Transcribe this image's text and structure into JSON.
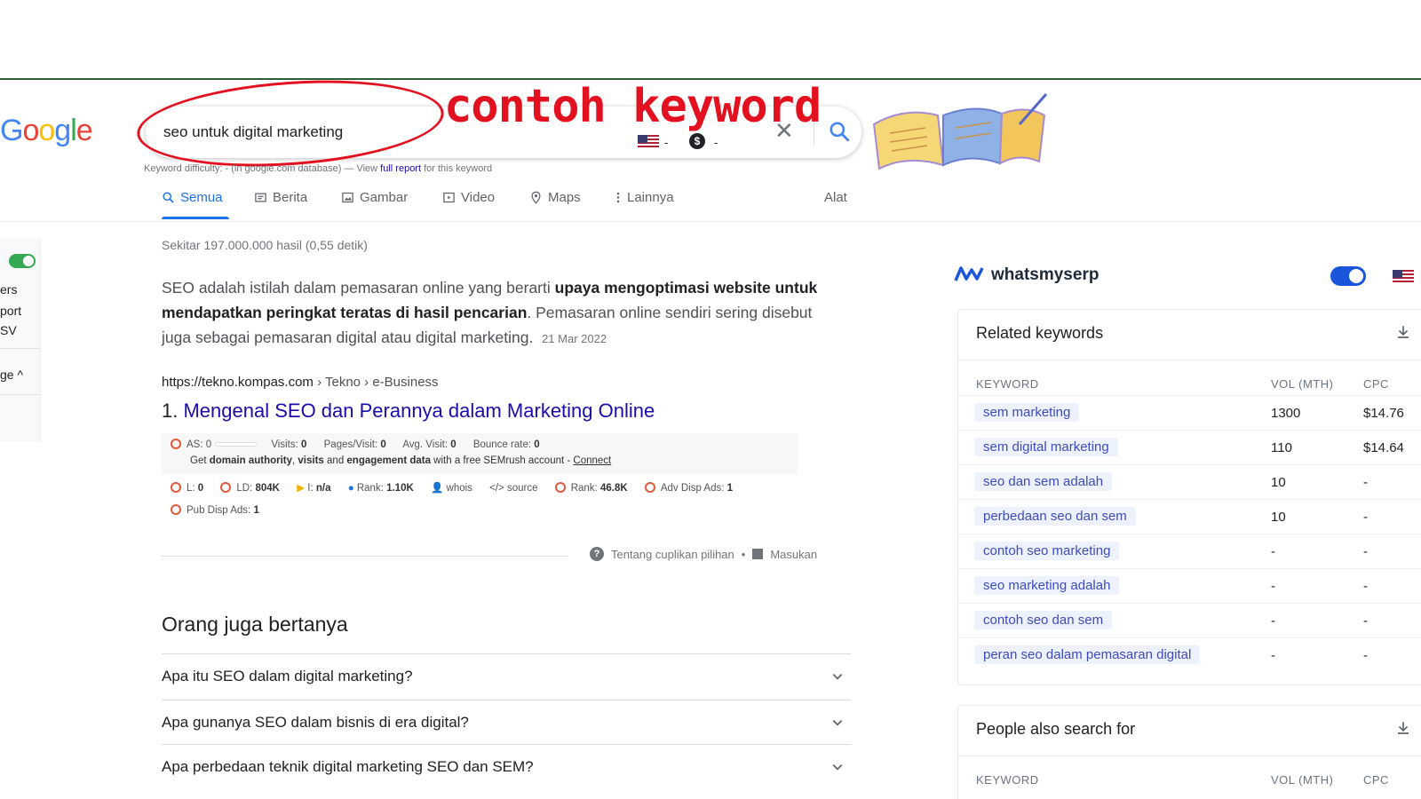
{
  "search": {
    "query": "seo untuk digital marketing",
    "flag_dash": "-",
    "cpc_symbol": "$",
    "cpc_dash": "-",
    "clear": "✕"
  },
  "annotation": {
    "label": "contoh keyword"
  },
  "keyword_difficulty_line": {
    "left": "Keyword difficulty: - (in google.com database) — View",
    "link": "full report",
    "right": "for this keyword"
  },
  "tabs": [
    {
      "label": "Semua",
      "icon": "search-icon"
    },
    {
      "label": "Berita",
      "icon": "news-icon"
    },
    {
      "label": "Gambar",
      "icon": "image-icon"
    },
    {
      "label": "Video",
      "icon": "video-icon"
    },
    {
      "label": "Maps",
      "icon": "map-pin-icon"
    },
    {
      "label": "Lainnya",
      "icon": "more-vert-icon"
    }
  ],
  "tools_label": "Alat",
  "left_panel": {
    "items": [
      "ers",
      "port",
      "SV",
      "ge ^"
    ]
  },
  "result_stats": "Sekitar 197.000.000 hasil (0,55 detik)",
  "snippet": {
    "part1": "SEO adalah istilah dalam pemasaran online yang berarti ",
    "bold": "upaya mengoptimasi website untuk mendapatkan peringkat teratas di hasil pencarian",
    "part2": ". Pemasaran online sendiri sering disebut juga sebagai pemasaran digital atau digital marketing.",
    "date": "21 Mar 2022"
  },
  "result": {
    "url": "https://tekno.kompas.com",
    "breadcrumb": " › Tekno › e-Business",
    "number": "1.",
    "title": "Mengenal SEO dan Perannya dalam Marketing Online"
  },
  "semrush": {
    "as_label": "AS: 0",
    "visits": "Visits: ",
    "visits_val": "0",
    "pages": "Pages/Visit: ",
    "pages_val": "0",
    "avg": "Avg. Visit: ",
    "avg_val": "0",
    "bounce": "Bounce rate: ",
    "bounce_val": "0",
    "cta_pre": "Get ",
    "cta_b1": "domain authority",
    "cta_mid": ", ",
    "cta_b2": "visits",
    "cta_and": " and ",
    "cta_b3": "engagement data",
    "cta_post": " with a free SEMrush account - ",
    "connect": "Connect",
    "l_label": "L: ",
    "l_val": "0",
    "ld_label": "LD: ",
    "ld_val": "804K",
    "i_label": "I: ",
    "i_val": "n/a",
    "rank1_label": "Rank: ",
    "rank1_val": "1.10K",
    "whois": "whois",
    "source": "source",
    "rank2_label": "Rank: ",
    "rank2_val": "46.8K",
    "adv_label": "Adv Disp Ads: ",
    "adv_val": "1",
    "pub_label": "Pub Disp Ads: ",
    "pub_val": "1"
  },
  "featured_footer": {
    "about": "Tentang cuplikan pilihan",
    "dot": "•",
    "feedback": "Masukan"
  },
  "paa": {
    "title": "Orang juga bertanya",
    "questions": [
      "Apa itu SEO dalam digital marketing?",
      "Apa gunanya SEO dalam bisnis di era digital?",
      "Apa perbedaan teknik digital marketing SEO dan SEM?"
    ]
  },
  "whatsmyserp": {
    "brand": "whatsmyserp",
    "related": {
      "title": "Related keywords",
      "headers": [
        "KEYWORD",
        "VOL (MTH)",
        "CPC"
      ],
      "rows": [
        {
          "keyword": "sem marketing",
          "vol": "1300",
          "cpc": "$14.76"
        },
        {
          "keyword": "sem digital marketing",
          "vol": "110",
          "cpc": "$14.64"
        },
        {
          "keyword": "seo dan sem adalah",
          "vol": "10",
          "cpc": "-"
        },
        {
          "keyword": "perbedaan seo dan sem",
          "vol": "10",
          "cpc": "-"
        },
        {
          "keyword": "contoh seo marketing",
          "vol": "-",
          "cpc": "-"
        },
        {
          "keyword": "seo marketing adalah",
          "vol": "-",
          "cpc": "-"
        },
        {
          "keyword": "contoh seo dan sem",
          "vol": "-",
          "cpc": "-"
        },
        {
          "keyword": "peran seo dalam pemasaran digital",
          "vol": "-",
          "cpc": "-"
        }
      ]
    },
    "people_also": {
      "title": "People also search for",
      "headers": [
        "KEYWORD",
        "VOL (MTH)",
        "CPC"
      ]
    }
  },
  "colors": {
    "link": "#1a0dab",
    "accent": "#1a73e8",
    "annotation": "#e3111f",
    "wms_blue": "#1a56db"
  }
}
